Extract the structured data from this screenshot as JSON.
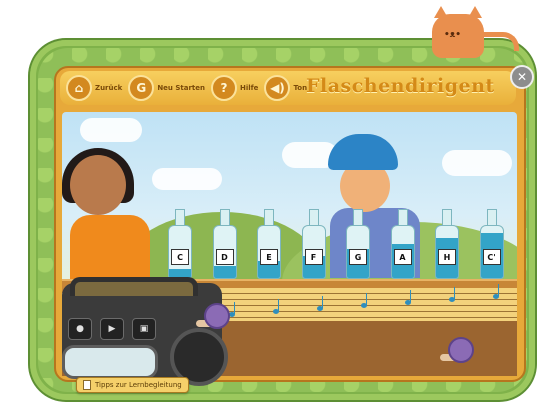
{
  "toolbar": {
    "back_label": "Zurück",
    "restart_label": "Neu Starten",
    "help_label": "Hilfe",
    "sound_label": "Ton",
    "title": "Flaschendirigent"
  },
  "bottles": [
    {
      "label": "C",
      "fill": 0.18
    },
    {
      "label": "D",
      "fill": 0.24
    },
    {
      "label": "E",
      "fill": 0.32
    },
    {
      "label": "F",
      "fill": 0.42
    },
    {
      "label": "G",
      "fill": 0.55
    },
    {
      "label": "A",
      "fill": 0.66
    },
    {
      "label": "H",
      "fill": 0.76
    },
    {
      "label": "C'",
      "fill": 0.86
    }
  ],
  "footer": {
    "tips_label": "Tipps zur Lernbegleitung"
  },
  "colors": {
    "frame": "#e7a93a",
    "water": "#33a4c8",
    "grass": "#7fb24a"
  }
}
